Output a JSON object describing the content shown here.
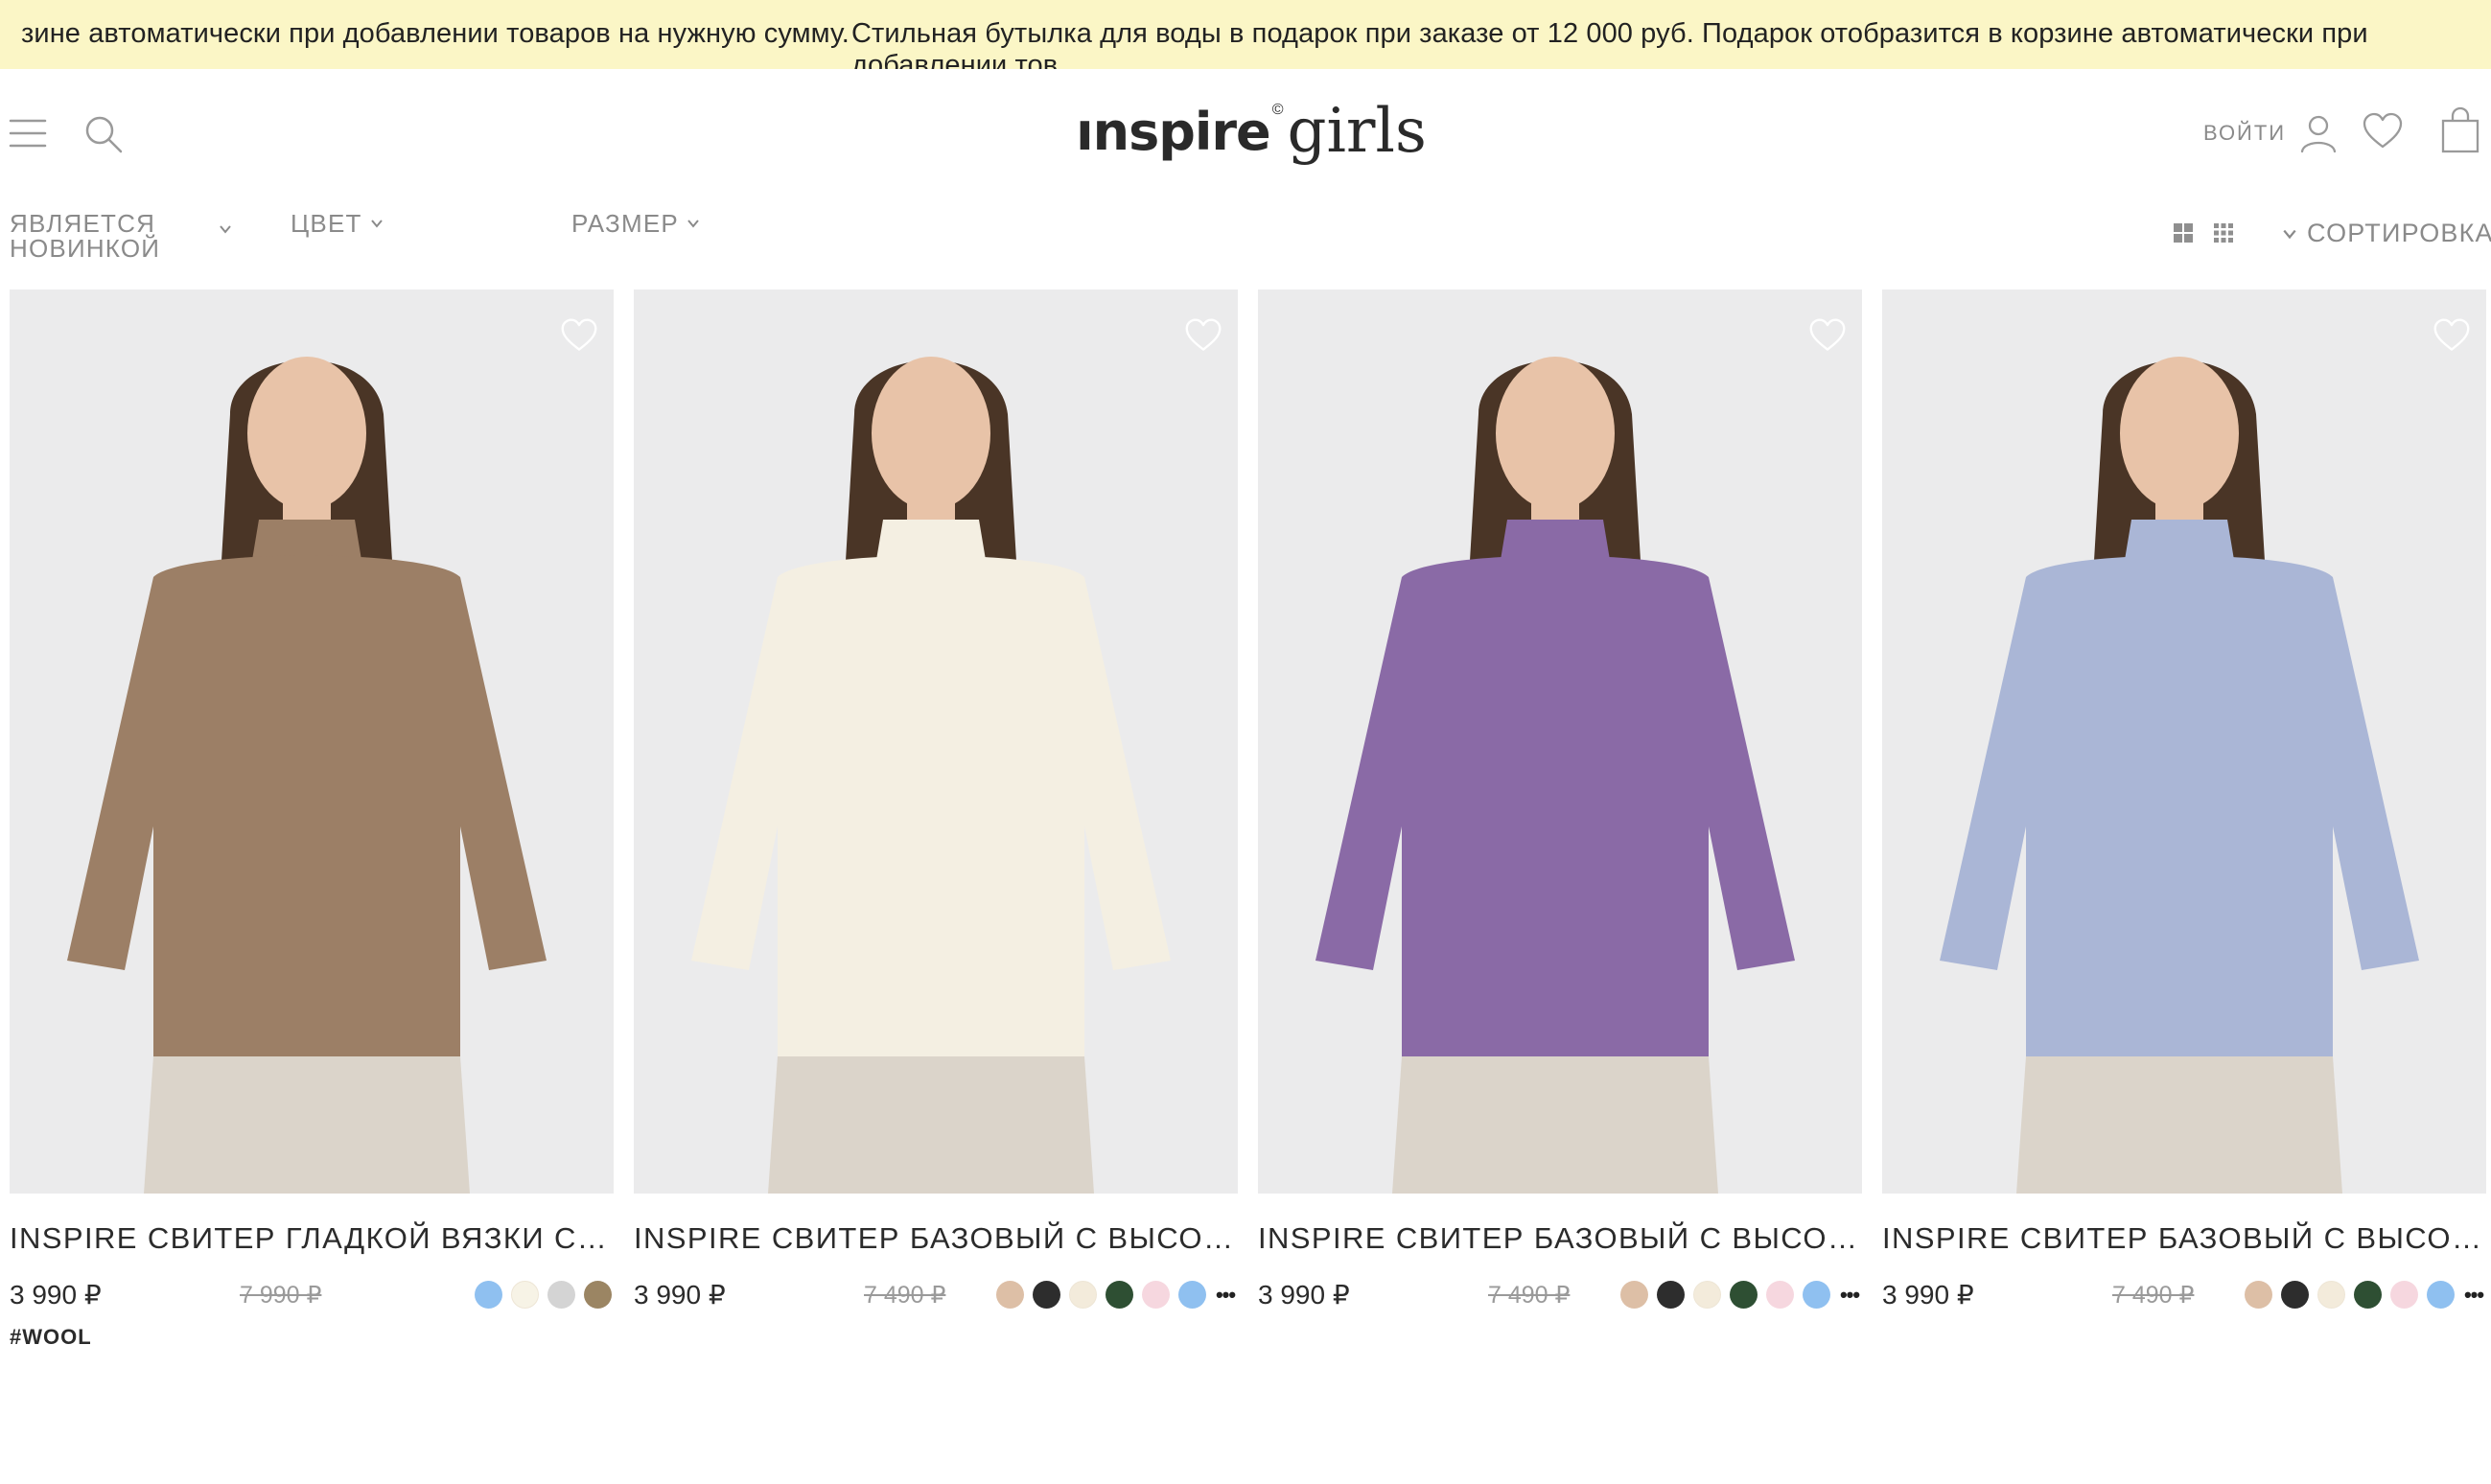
{
  "promo": {
    "text_first": "зине автоматически при добавлении товаров на нужную сумму.",
    "text_second": "Стильная бутылка для воды в подарок при заказе от 12 000 руб. Подарок отобразится в корзине автоматически при добавлении тов"
  },
  "header": {
    "logo_bold": "ınspire",
    "logo_light": "girls",
    "logo_mark": "©",
    "login_label": "ВОЙТИ"
  },
  "filters": {
    "new_label": "ЯВЛЯЕТСЯ НОВИНКОЙ",
    "color_label": "ЦВЕТ",
    "size_label": "РАЗМЕР",
    "sort_label": "СОРТИРОВКА"
  },
  "products": [
    {
      "title": "INSPIRE СВИТЕР ГЛАДКОЙ ВЯЗКИ С ВОРОТНИКОМ",
      "price": "3 990 ₽",
      "old_price": "7 990 ₽",
      "tag": "#WOOL",
      "sweater_color": "#9c7f66",
      "swatches": [
        "#8fc0f0",
        "#f7f3e6",
        "#d4d4d4",
        "#9b8563"
      ],
      "has_more": false
    },
    {
      "title": "INSPIRE СВИТЕР БАЗОВЫЙ С ВЫСОКИМ ВОРОТНИКОМ",
      "price": "3 990 ₽",
      "old_price": "7 490 ₽",
      "tag": "",
      "sweater_color": "#f4efe2",
      "swatches": [
        "#ddbfa6",
        "#2d2d2d",
        "#f3ebdb",
        "#2e4f33",
        "#f6d7df",
        "#8fc0f0"
      ],
      "has_more": true
    },
    {
      "title": "INSPIRE СВИТЕР БАЗОВЫЙ С ВЫСОКИМ ВОРОТНИКОМ",
      "price": "3 990 ₽",
      "old_price": "7 490 ₽",
      "tag": "",
      "sweater_color": "#8a6aa6",
      "swatches": [
        "#ddbfa6",
        "#2d2d2d",
        "#f3ebdb",
        "#2e4f33",
        "#f6d7df",
        "#8fc0f0"
      ],
      "has_more": true
    },
    {
      "title": "INSPIRE СВИТЕР БАЗОВЫЙ С ВЫСОКИМ ВОРОТНИКОМ",
      "price": "3 990 ₽",
      "old_price": "7 490 ₽",
      "tag": "",
      "sweater_color": "#aab6d6",
      "swatches": [
        "#ddbfa6",
        "#2d2d2d",
        "#f3ebdb",
        "#2e4f33",
        "#f6d7df",
        "#8fc0f0"
      ],
      "has_more": true
    }
  ],
  "more_symbol": "•••"
}
